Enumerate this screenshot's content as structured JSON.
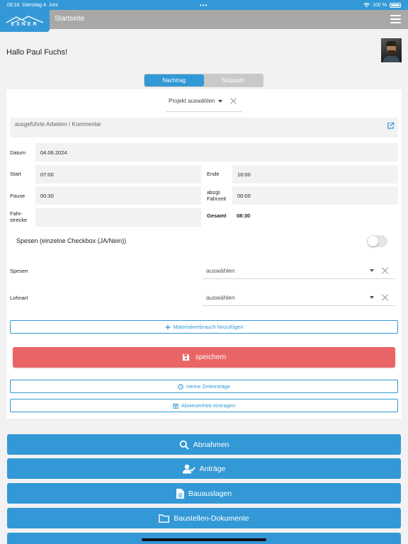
{
  "status": {
    "time": "09:18",
    "date": "Dienstag 4. Juni",
    "battery": "100 %"
  },
  "nav": {
    "title": "Startseite",
    "logo_text": "EXNER"
  },
  "greeting": "Hallo Paul Fuchs!",
  "segment": {
    "options": [
      "Nachtrag",
      "Stoppuhr"
    ],
    "active": 0
  },
  "form": {
    "project_placeholder": "Projekt auswählen",
    "comment_placeholder": "ausgeführte Arbeiten / Kommentar",
    "datum": {
      "label": "Datum",
      "value": "04.06.2024"
    },
    "start": {
      "label": "Start",
      "value": "07:00"
    },
    "ende": {
      "label": "Ende",
      "value": "16:00"
    },
    "pause": {
      "label": "Pause",
      "value": "00:30"
    },
    "fahrzeit": {
      "label_1": "abzgl.",
      "label_2": "Fahrzeit",
      "value": "00:00"
    },
    "fahrstrecke": {
      "label_1": "Fahr-",
      "label_2": "strecke",
      "value": ""
    },
    "gesamt": {
      "label": "Gesamt",
      "value": "08:30"
    },
    "spesen_checkbox": {
      "label": "Spesen  (einzelne Checkbox (JA/Nein))",
      "checked": false
    },
    "spesen_select": {
      "label": "Spesen",
      "placeholder": "auswählen"
    },
    "lohnart_select": {
      "label": "Lohnart",
      "placeholder": "auswählen"
    },
    "material_button": "Materialverbrauch hinzufügen",
    "save_button": "speichern",
    "zeiteintraege_button": "meine Zeiteinträge",
    "abwesenheit_button": "Abwesenheit eintragen"
  },
  "menu": [
    {
      "label": "Abnahmen",
      "icon": "search-icon"
    },
    {
      "label": "Anträge",
      "icon": "user-check-icon"
    },
    {
      "label": "Bauauslagen",
      "icon": "document-icon"
    },
    {
      "label": "Baustellen-Dokumente",
      "icon": "folder-icon"
    }
  ],
  "colors": {
    "primary": "#3399d6",
    "save": "#e96565",
    "navbar": "#a8a8a8",
    "background": "#f2f2f2"
  }
}
